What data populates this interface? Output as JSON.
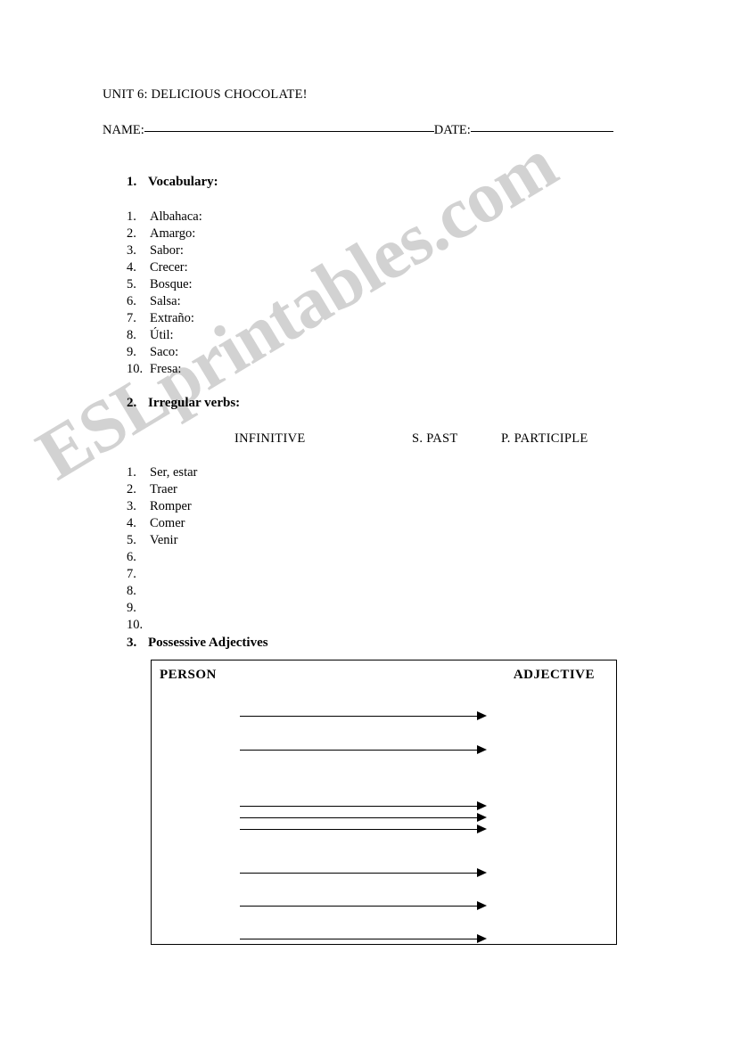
{
  "document": {
    "unit_title": "UNIT 6: DELICIOUS CHOCOLATE!",
    "name_label": "NAME:",
    "date_label": "DATE:"
  },
  "section1": {
    "number": "1.",
    "title": "Vocabulary:",
    "items": [
      {
        "n": "1.",
        "text": "Albahaca:"
      },
      {
        "n": "2.",
        "text": "Amargo:"
      },
      {
        "n": "3.",
        "text": "Sabor:"
      },
      {
        "n": "4.",
        "text": "Crecer:"
      },
      {
        "n": "5.",
        "text": "Bosque:"
      },
      {
        "n": "6.",
        "text": "Salsa:"
      },
      {
        "n": "7.",
        "text": "Extraño:"
      },
      {
        "n": "8.",
        "text": "Útil:"
      },
      {
        "n": "9.",
        "text": "Saco:"
      },
      {
        "n": "10.",
        "text": "Fresa:"
      }
    ]
  },
  "section2": {
    "number": "2.",
    "title": "Irregular verbs:",
    "columns": {
      "infinitive": "INFINITIVE",
      "simple_past": "S. PAST",
      "past_participle": "P. PARTICIPLE"
    },
    "items": [
      {
        "n": "1.",
        "text": "Ser, estar"
      },
      {
        "n": "2.",
        "text": "Traer"
      },
      {
        "n": "3.",
        "text": "Romper"
      },
      {
        "n": "4.",
        "text": "Comer"
      },
      {
        "n": "5.",
        "text": "Venir"
      },
      {
        "n": "6.",
        "text": ""
      },
      {
        "n": "7.",
        "text": ""
      },
      {
        "n": "8.",
        "text": ""
      },
      {
        "n": "9.",
        "text": ""
      },
      {
        "n": "10.",
        "text": ""
      }
    ]
  },
  "section3": {
    "number": "3.",
    "title": "Possessive Adjectives",
    "table": {
      "header_left": "PERSON",
      "header_right": "ADJECTIVE",
      "arrow_count": 7
    }
  },
  "watermark": {
    "text": "ESLprintables.com",
    "color": "#d2d2d2"
  }
}
